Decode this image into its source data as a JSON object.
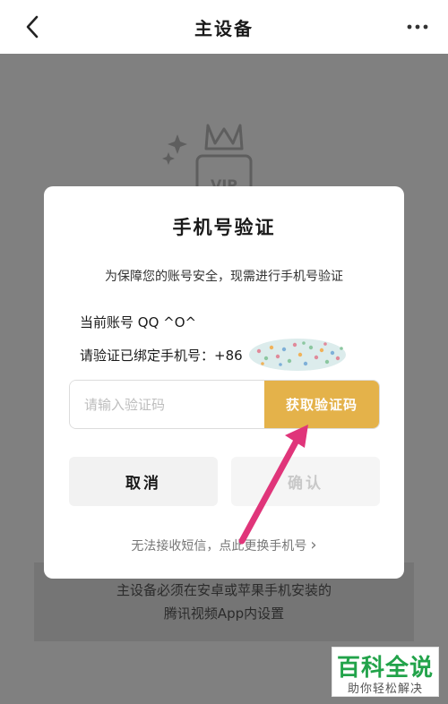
{
  "header": {
    "title": "主设备"
  },
  "background": {
    "note_line1": "主设备必须在安卓或苹果手机安装的",
    "note_line2": "腾讯视频App内设置",
    "vip_badge": "VIP"
  },
  "dialog": {
    "title": "手机号验证",
    "description": "为保障您的账号安全，现需进行手机号验证",
    "account_label": "当前账号 QQ ^O^",
    "phone_label": "请验证已绑定手机号：+86",
    "code_input_placeholder": "请输入验证码",
    "get_code_label": "获取验证码",
    "cancel_label": "取消",
    "confirm_label": "确认",
    "change_phone_link": "无法接收短信，点此更换手机号",
    "change_phone_chevron": "›"
  },
  "watermark": {
    "main": "百科全说",
    "sub": "助你轻松解决"
  },
  "colors": {
    "accent": "#e4b24a",
    "arrow": "#e0357a",
    "overlay": "#808080",
    "watermark_green": "#22a34a"
  }
}
